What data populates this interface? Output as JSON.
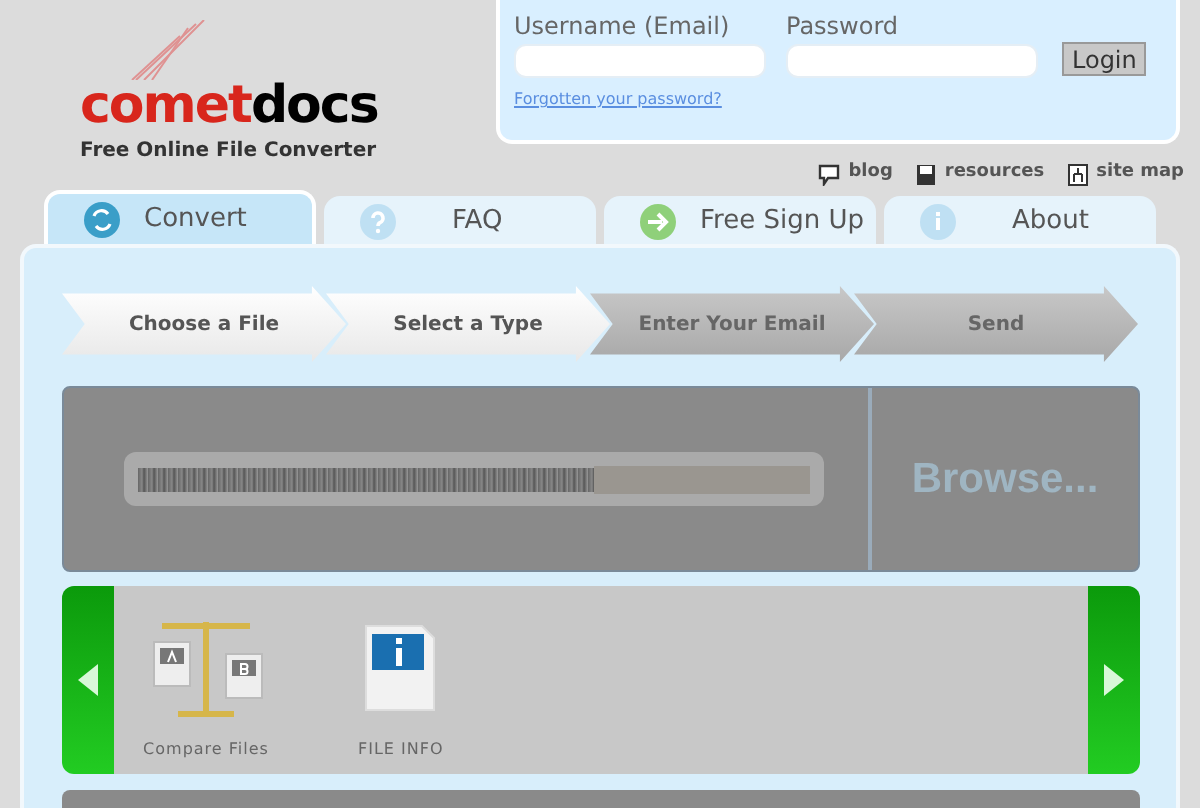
{
  "logo": {
    "name_red": "comet",
    "name_dark": "docs",
    "tagline": "Free Online File Converter"
  },
  "login": {
    "username_label": "Username (Email)",
    "password_label": "Password",
    "button": "Login",
    "forgot_link": "Forgotten your password?"
  },
  "top_links": [
    {
      "kind": "blog",
      "label": "blog"
    },
    {
      "kind": "resources",
      "label": "resources"
    },
    {
      "kind": "sitemap",
      "label": "site map"
    }
  ],
  "tabs": [
    {
      "kind": "convert",
      "label": "Convert",
      "selected": true
    },
    {
      "kind": "faq",
      "label": "FAQ",
      "selected": false
    },
    {
      "kind": "signup",
      "label": "Free Sign Up",
      "selected": false
    },
    {
      "kind": "about",
      "label": "About",
      "selected": false
    }
  ],
  "steps": [
    {
      "label": "Choose a File",
      "completed": true
    },
    {
      "label": "Select a Type",
      "completed": true
    },
    {
      "label": "Enter Your Email",
      "completed": false
    },
    {
      "label": "Send",
      "completed": false
    }
  ],
  "upload": {
    "browse_button": "Browse..."
  },
  "tools": [
    {
      "kind": "compare",
      "label": "Compare Files"
    },
    {
      "kind": "info",
      "label": "FILE INFO"
    }
  ]
}
